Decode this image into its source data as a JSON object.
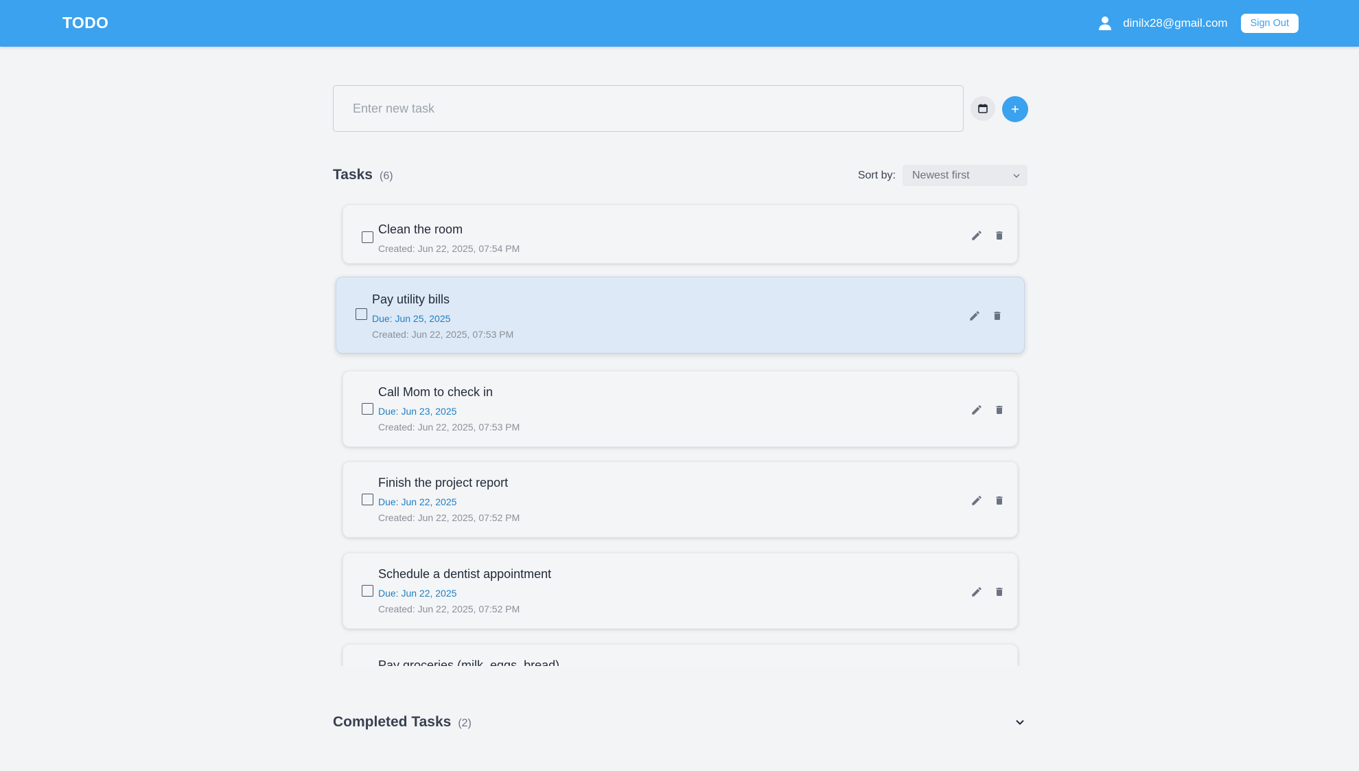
{
  "app": {
    "title": "TODO"
  },
  "user": {
    "email": "dinilx28@gmail.com",
    "icon": "user-icon"
  },
  "header": {
    "signout_label": "Sign Out"
  },
  "new_task": {
    "placeholder": "Enter new task",
    "date_icon": "calendar-icon",
    "add_icon": "plus-icon"
  },
  "tasks": {
    "title": "Tasks",
    "count": "(6)",
    "sort_label": "Sort by:",
    "sort_value": "Newest first",
    "items": [
      {
        "title": "Clean the room",
        "due": "",
        "created": "Created: Jun 22, 2025, 07:54 PM"
      },
      {
        "title": "Pay utility bills",
        "due": "Due: Jun 25, 2025",
        "created": "Created: Jun 22, 2025, 07:53 PM"
      },
      {
        "title": "Call Mom to check in",
        "due": "Due: Jun 23, 2025",
        "created": "Created: Jun 22, 2025, 07:53 PM"
      },
      {
        "title": "Finish the project report",
        "due": "Due: Jun 22, 2025",
        "created": "Created: Jun 22, 2025, 07:52 PM"
      },
      {
        "title": "Schedule a dentist appointment",
        "due": "Due: Jun 22, 2025",
        "created": "Created: Jun 22, 2025, 07:52 PM"
      },
      {
        "title": "Pay groceries (milk, eggs, bread)",
        "due": "",
        "created": ""
      }
    ]
  },
  "completed": {
    "title": "Completed Tasks",
    "count": "(2)"
  },
  "colors": {
    "primary": "#3aa2ee",
    "due": "#1d7fc4",
    "selected": "#dde9f6"
  }
}
